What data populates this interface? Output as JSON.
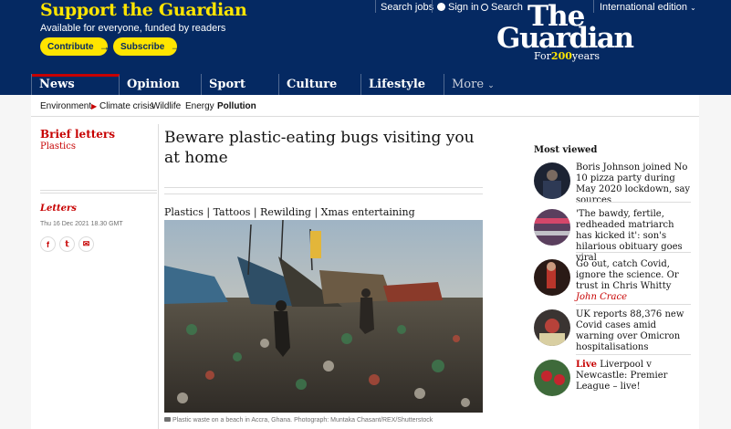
{
  "support": {
    "title": "Support the Guardian",
    "subtitle": "Available for everyone, funded by readers",
    "contribute_label": "Contribute",
    "subscribe_label": "Subscribe"
  },
  "top_links": {
    "search_jobs": "Search jobs",
    "sign_in": "Sign in",
    "search": "Search",
    "edition": "International edition"
  },
  "logo": {
    "the": "The",
    "guardian": "Guardian",
    "tag_prefix": "For",
    "tag_number": "200",
    "tag_suffix": "years"
  },
  "nav": {
    "items": [
      "News",
      "Opinion",
      "Sport",
      "Culture",
      "Lifestyle"
    ],
    "more": "More"
  },
  "subnav": {
    "items": [
      "Environment",
      "Climate crisis",
      "Wildlife",
      "Energy",
      "Pollution"
    ]
  },
  "article": {
    "kicker": "Brief letters",
    "kicker_sub": "Plastics",
    "series": "Letters",
    "date": "Thu 16 Dec 2021 18.30 GMT",
    "headline": "Beware plastic-eating bugs visiting you at home",
    "topics": "Plastics | Tattoos | Rewilding | Xmas entertaining",
    "caption": "Plastic waste on a beach in Accra, Ghana. Photograph: Muntaka Chasant/REX/Shutterstock"
  },
  "most_viewed": {
    "title": "Most viewed",
    "items": [
      {
        "text": "Boris Johnson joined No 10 pizza party during May 2020 lockdown, say sources"
      },
      {
        "text": "'The bawdy, fertile, redheaded matriarch has kicked it': son's hilarious obituary goes viral"
      },
      {
        "text": "Go out, catch Covid, ignore the science. Or trust in Chris Whitty",
        "byline": "John Crace"
      },
      {
        "text": "UK reports 88,376 new Covid cases amid warning over Omicron hospitalisations"
      },
      {
        "live": "Live",
        "text": "Liverpool v Newcastle: Premier League – live!"
      }
    ]
  },
  "colors": {
    "brand_blue": "#052962",
    "support_yellow": "#ffe500",
    "news_red": "#c70000"
  }
}
